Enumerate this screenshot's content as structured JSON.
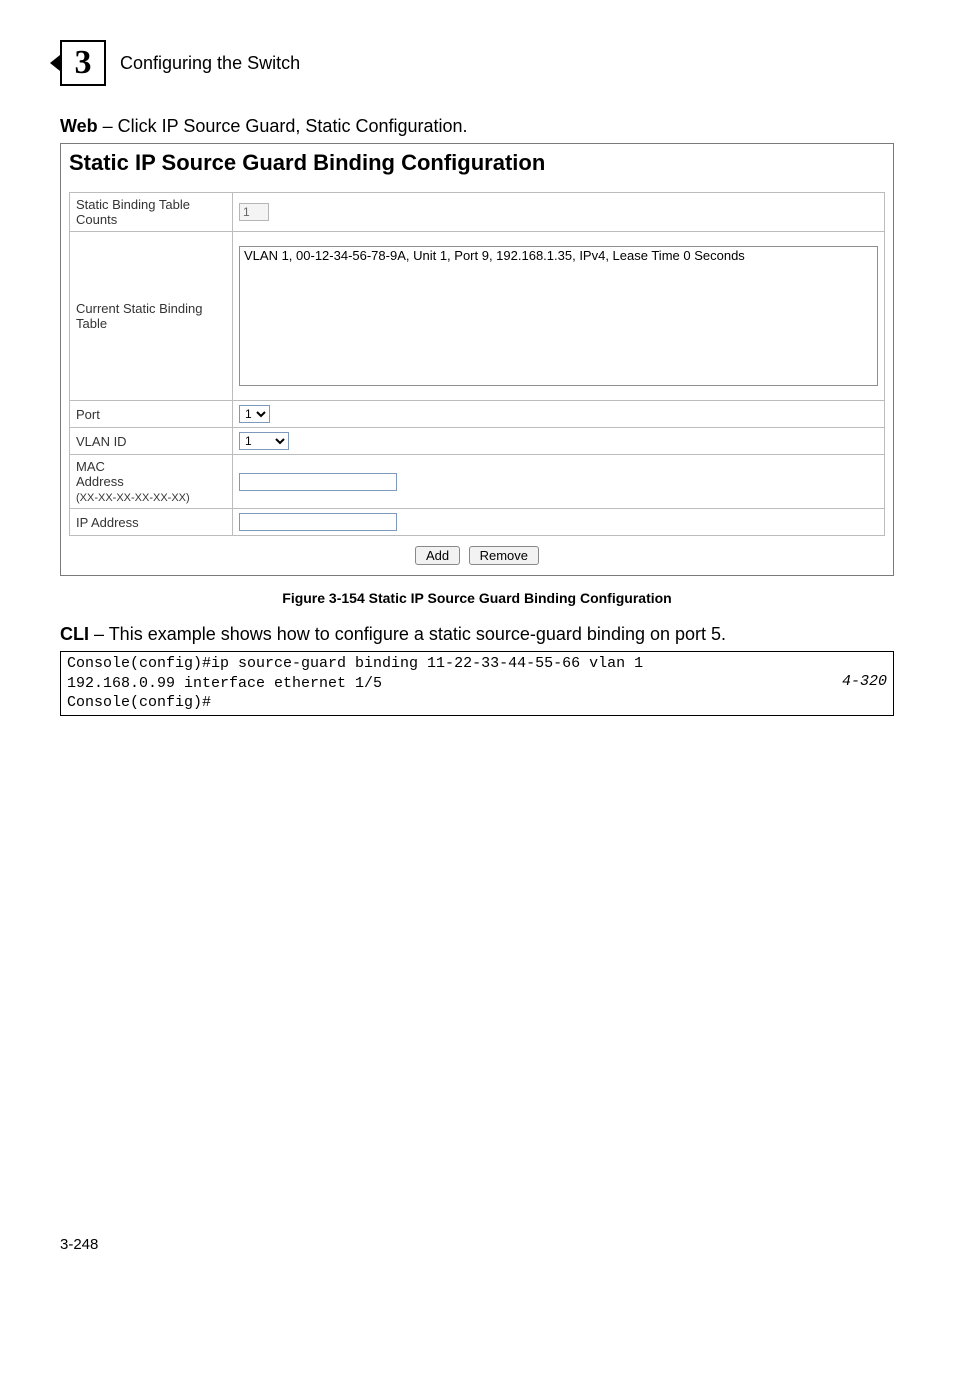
{
  "header": {
    "chapter_number": "3",
    "chapter_title": "Configuring the Switch"
  },
  "intro": {
    "web_prefix": "Web",
    "web_text": " – Click IP Source Guard, Static Configuration."
  },
  "screenshot": {
    "title": "Static IP Source Guard Binding Configuration",
    "rows": {
      "counts_label": "Static Binding Table Counts",
      "counts_value": "1",
      "binding_table_label": "Current Static Binding Table",
      "binding_table_entry": "VLAN 1, 00-12-34-56-78-9A, Unit 1, Port 9, 192.168.1.35, IPv4, Lease Time 0 Seconds",
      "port_label": "Port",
      "port_value": "1",
      "vlan_label": "VLAN ID",
      "vlan_value": "1",
      "mac_label_line1": "MAC",
      "mac_label_line2": "Address",
      "mac_label_line3": "(XX-XX-XX-XX-XX-XX)",
      "ip_label": "IP Address"
    },
    "buttons": {
      "add": "Add",
      "remove": "Remove"
    }
  },
  "figure_caption": "Figure 3-154  Static IP Source Guard Binding Configuration",
  "cli": {
    "prefix": "CLI",
    "text": " – This example shows how to configure a static source-guard binding on port 5.",
    "line1": "Console(config)#ip source-guard binding 11-22-33-44-55-66 vlan 1 ",
    "line2": "192.168.0.99 interface ethernet 1/5",
    "line3": "Console(config)#",
    "ref": "4-320"
  },
  "page_number": "3-248"
}
